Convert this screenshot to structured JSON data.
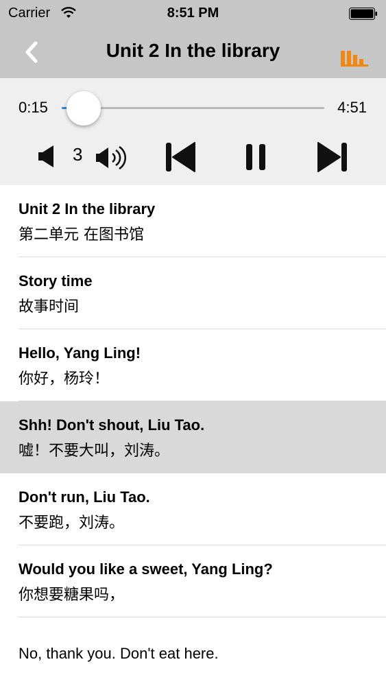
{
  "status_bar": {
    "carrier": "Carrier",
    "time": "8:51 PM"
  },
  "nav": {
    "title": "Unit 2 In the library",
    "back_icon": "chevron-left-icon",
    "levels_icon": "bars-icon",
    "accent_color": "#f0880f"
  },
  "player": {
    "elapsed": "0:15",
    "total": "4:51",
    "progress": 0.052,
    "volume_level": "3",
    "track_color": "#2a8be0",
    "state": "playing"
  },
  "sentences": [
    {
      "en": "Unit 2 In the library",
      "zh": "第二单元 在图书馆"
    },
    {
      "en": "Story time",
      "zh": "故事时间"
    },
    {
      "en": "Hello, Yang Ling!",
      "zh": "你好，杨玲！"
    },
    {
      "en": "Shh! Don't shout, Liu Tao.",
      "zh": "嘘！不要大叫，刘涛。"
    },
    {
      "en": "Don't run, Liu Tao.",
      "zh": "不要跑，刘涛。"
    },
    {
      "en": "Would you like a sweet, Yang Ling?",
      "zh": "你想要糖果吗，"
    },
    {
      "en": "No, thank you. Don't eat here."
    }
  ]
}
